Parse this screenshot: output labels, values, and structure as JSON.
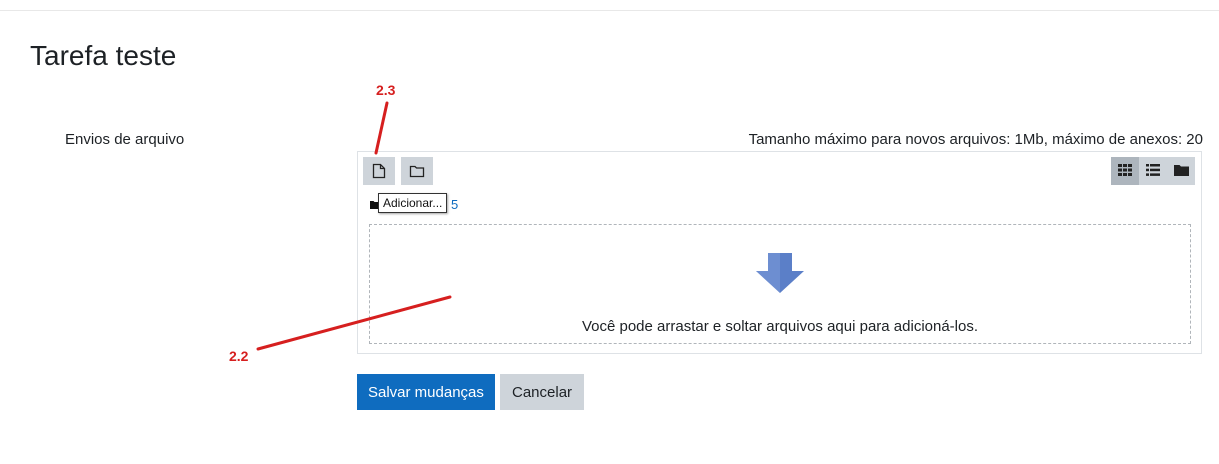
{
  "page": {
    "title": "Tarefa teste"
  },
  "form": {
    "field_label": "Envios de arquivo",
    "max_size_text": "Tamanho máximo para novos arquivos: 1Mb, máximo de anexos: 20"
  },
  "filepicker": {
    "toolbar": {
      "add_file_icon": "file-icon",
      "create_folder_icon": "folder-outline-icon",
      "view_icons": [
        "grid-view-icon",
        "list-view-icon",
        "folder-tree-icon"
      ]
    },
    "path_link": "5",
    "tooltip": "Adicionar...",
    "dropzone_text": "Você pode arrastar e soltar arquivos aqui para adicioná-los."
  },
  "buttons": {
    "save": "Salvar mudanças",
    "cancel": "Cancelar"
  },
  "annotations": {
    "label_a": "2.3",
    "label_b": "2.2",
    "color": "#d61f1f"
  },
  "colors": {
    "primary": "#0f6cbf",
    "secondary": "#ced4da",
    "arrow": "#5b7fc8"
  }
}
